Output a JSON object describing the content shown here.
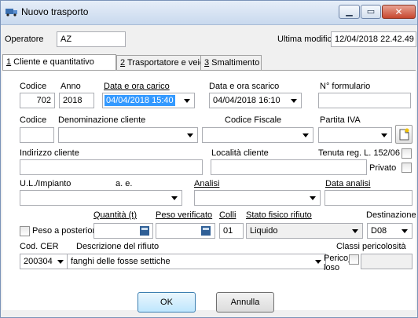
{
  "window": {
    "title": "Nuovo trasporto",
    "title_icon": "truck-icon"
  },
  "header": {
    "operatore_label": "Operatore",
    "operatore_value": "AZ",
    "ultima_modifica_label": "Ultima modifica",
    "ultima_modifica_value": "12/04/2018 22.42.49"
  },
  "tabs": [
    {
      "key": "1",
      "label": " Cliente e quantitativo"
    },
    {
      "key": "2",
      "label": " Trasportatore e veicoli"
    },
    {
      "key": "3",
      "label": " Smaltimento"
    }
  ],
  "form": {
    "codice_label": "Codice",
    "codice_value": "702",
    "anno_label": "Anno",
    "anno_value": "2018",
    "data_carico_label": "Data e ora carico",
    "data_carico_value": "04/04/2018 15:40",
    "data_scarico_label": "Data e ora scarico",
    "data_scarico_value": "04/04/2018 16:10",
    "formulario_label": "N° formulario",
    "formulario_value": "",
    "codice2_label": "Codice",
    "denominazione_label": "Denominazione cliente",
    "codice_fiscale_label": "Codice Fiscale",
    "partita_iva_label": "Partita IVA",
    "indirizzo_label": "Indirizzo cliente",
    "localita_label": "Località cliente",
    "tenuta_label": "Tenuta reg. L. 152/06",
    "privato_label": "Privato",
    "ul_label": "U.L./Impianto",
    "ae_label": "a. e.",
    "analisi_label": "Analisi",
    "data_analisi_label": "Data analisi",
    "quantita_label": "Quantità (t)",
    "peso_verificato_label": "Peso verificato",
    "colli_label": "Colli",
    "colli_value": "01",
    "stato_label": "Stato fisico rifiuto",
    "stato_value": "Liquido",
    "destinazione_label": "Destinazione",
    "destinazione_value": "D08",
    "peso_posteriori_label": "Peso a posteriori",
    "cer_label": "Cod. CER",
    "cer_value": "200304",
    "descrizione_label": "Descrizione del rifiuto",
    "descrizione_value": "fanghi delle fosse settiche",
    "classi_label": "Classi pericolosità",
    "pericoloso_label_1": "Perico_",
    "pericoloso_label_2": "loso"
  },
  "buttons": {
    "ok": "OK",
    "annulla": "Annulla"
  },
  "colors": {
    "selection": "#3399ff",
    "titlebar": "#c9d9ee",
    "close": "#c7472f"
  }
}
